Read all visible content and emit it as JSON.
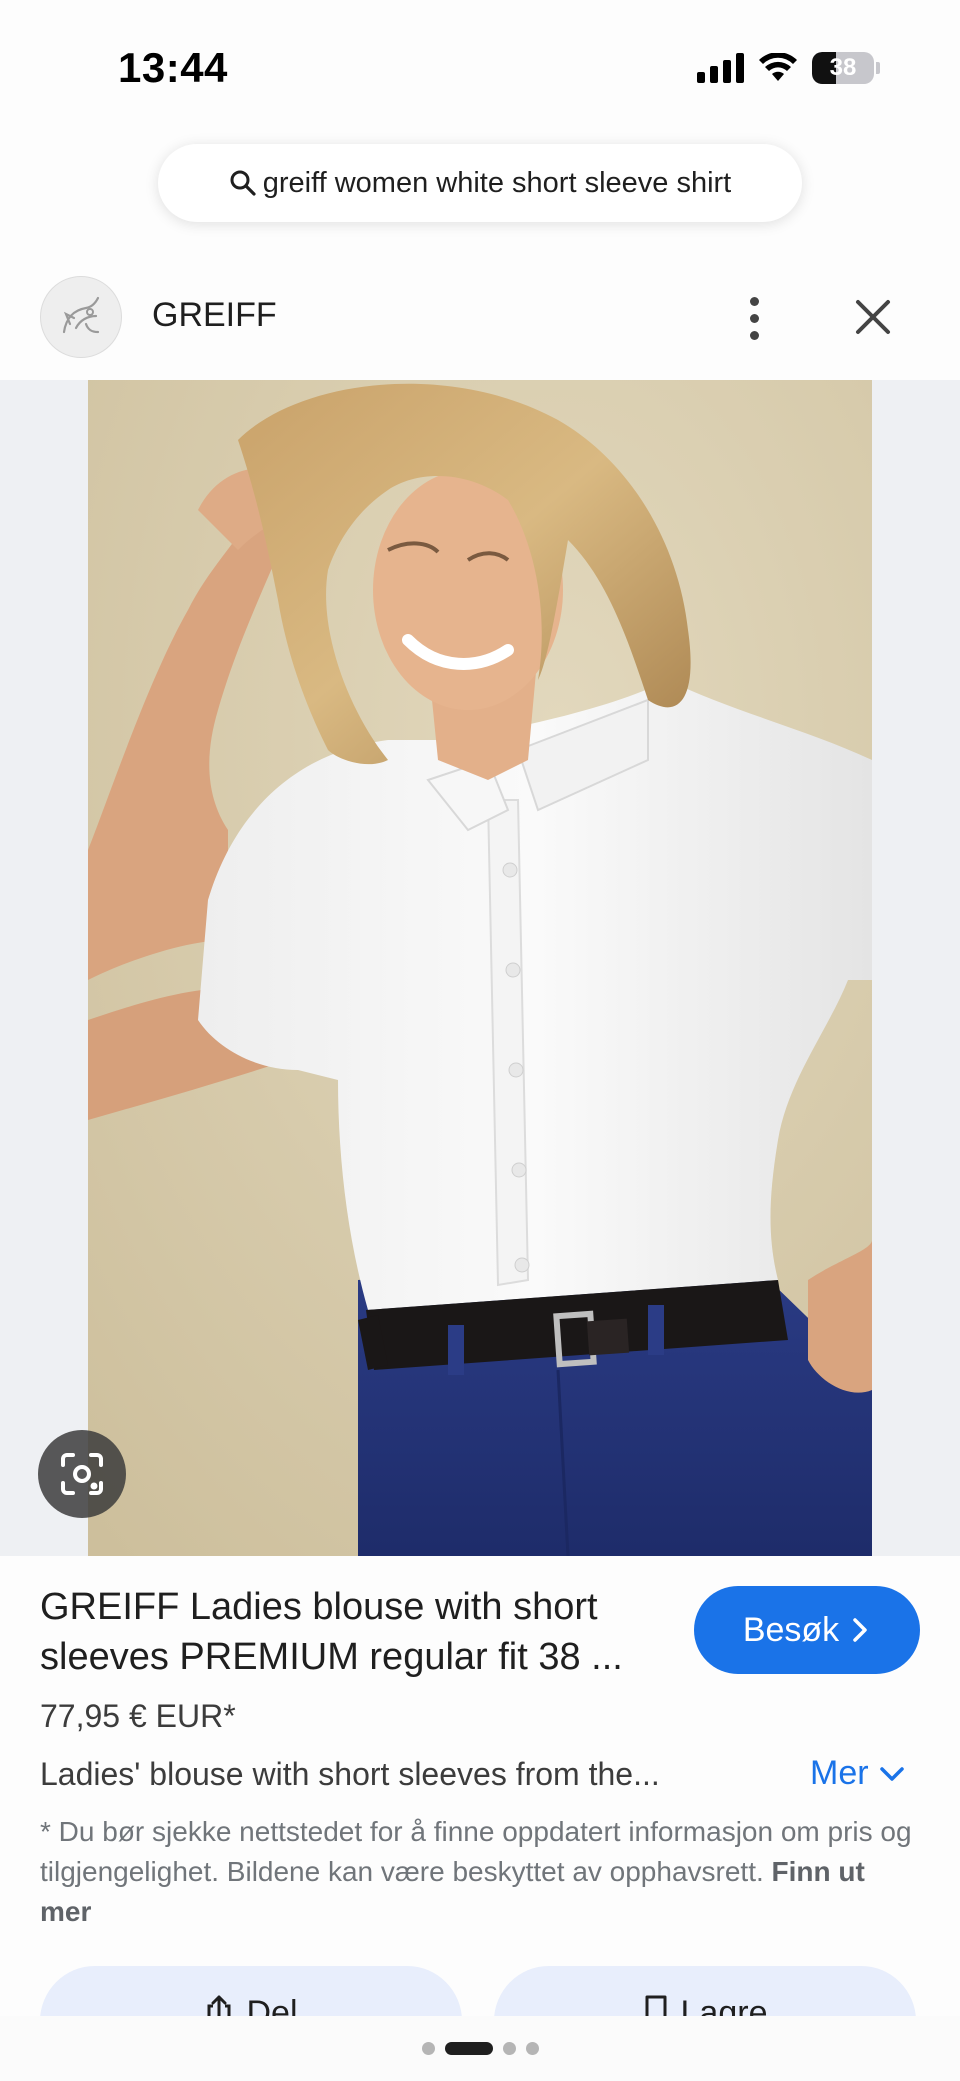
{
  "status_bar": {
    "time": "13:44",
    "battery": "38",
    "battery_level": 0.38
  },
  "search": {
    "query": "greiff women white short sleeve shirt"
  },
  "source": {
    "name": "GREIFF"
  },
  "product": {
    "title": "GREIFF Ladies blouse with short sleeves PREMIUM regular fit 38 ...",
    "price": "77,95 € EUR*",
    "description": "Ladies' blouse with short sleeves from the...",
    "visit_label": "Besøk",
    "more_label": "Mer"
  },
  "disclaimer": {
    "text": "* Du bør sjekke nettstedet for å finne oppdatert informasjon om pris og tilgjengelighet. Bildene kan være beskyttet av opphavsrett.",
    "link": "Finn ut mer"
  },
  "actions": {
    "share_label": "Del",
    "save_label": "Lagre"
  },
  "pager": {
    "count": 4,
    "active_index": 1
  },
  "colors": {
    "accent": "#1a73e8",
    "action_bg": "#e8eefc",
    "backdrop": "#d8cdb0",
    "pants": "#2a3a80"
  }
}
